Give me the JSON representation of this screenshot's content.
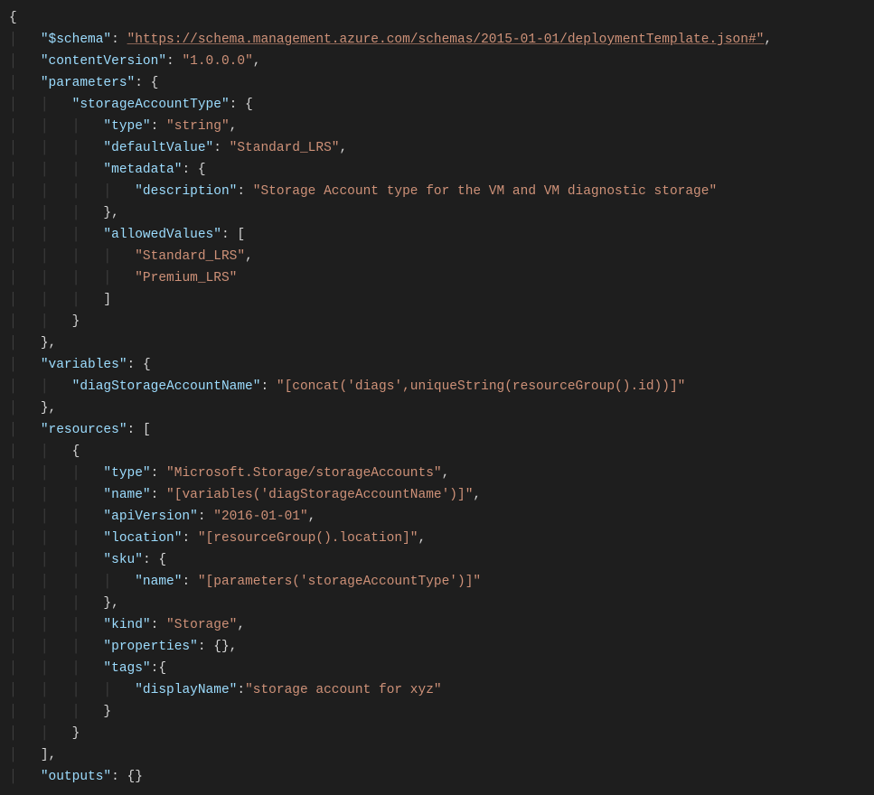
{
  "code": {
    "keys": {
      "schema": "\"$schema\"",
      "contentVersion": "\"contentVersion\"",
      "parameters": "\"parameters\"",
      "storageAccountType": "\"storageAccountType\"",
      "type": "\"type\"",
      "defaultValue": "\"defaultValue\"",
      "metadata": "\"metadata\"",
      "description": "\"description\"",
      "allowedValues": "\"allowedValues\"",
      "variables": "\"variables\"",
      "diagStorageAccountName": "\"diagStorageAccountName\"",
      "resources": "\"resources\"",
      "name": "\"name\"",
      "apiVersion": "\"apiVersion\"",
      "location": "\"location\"",
      "sku": "\"sku\"",
      "kind": "\"kind\"",
      "properties": "\"properties\"",
      "tags": "\"tags\"",
      "displayName": "\"displayName\"",
      "outputs": "\"outputs\""
    },
    "vals": {
      "schemaUrl": "\"https://schema.management.azure.com/schemas/2015-01-01/deploymentTemplate.json#\"",
      "contentVersion": "\"1.0.0.0\"",
      "typeString": "\"string\"",
      "standardLRS": "\"Standard_LRS\"",
      "premiumLRS": "\"Premium_LRS\"",
      "descriptionText": "\"Storage Account type for the VM and VM diagnostic storage\"",
      "diagExpr": "\"[concat('diags',uniqueString(resourceGroup().id))]\"",
      "resType": "\"Microsoft.Storage/storageAccounts\"",
      "resName": "\"[variables('diagStorageAccountName')]\"",
      "apiVersionVal": "\"2016-01-01\"",
      "locationVal": "\"[resourceGroup().location]\"",
      "skuName": "\"[parameters('storageAccountType')]\"",
      "kindVal": "\"Storage\"",
      "displayNameVal": "\"storage account for xyz\""
    }
  }
}
